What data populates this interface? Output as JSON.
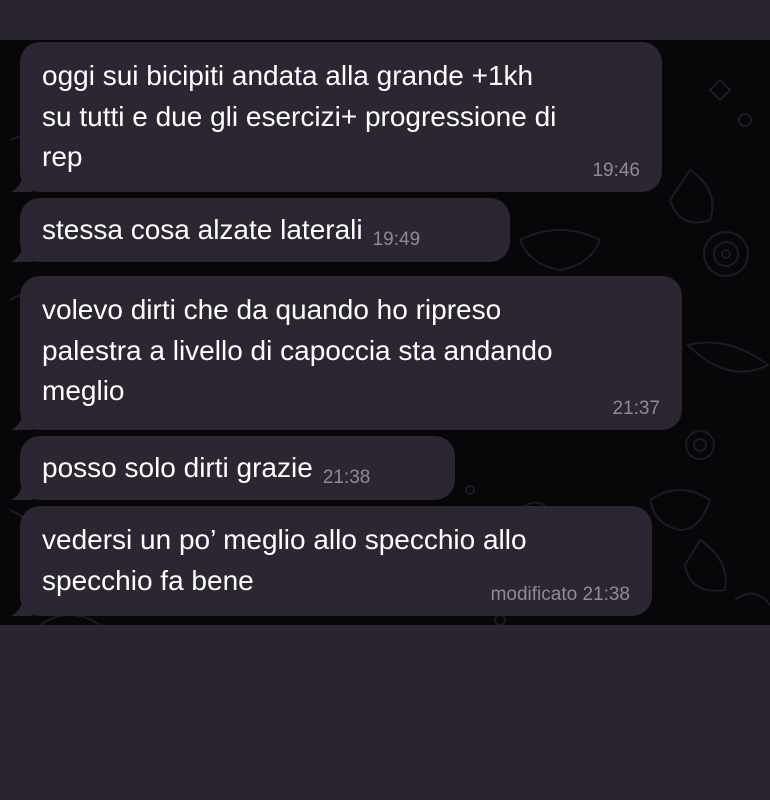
{
  "messages": [
    {
      "lines": [
        "oggi sui bicipiti andata alla grande +1kh",
        "su tutti e due gli esercizi+ progressione di",
        "rep"
      ],
      "time": "19:46"
    },
    {
      "lines": [
        "stessa cosa alzate laterali"
      ],
      "time": "19:49"
    },
    {
      "lines": [
        "volevo dirti che da quando ho ripreso",
        "palestra a livello di capoccia sta andando",
        "meglio"
      ],
      "time": "21:37"
    },
    {
      "lines": [
        "posso solo dirti grazie"
      ],
      "time": "21:38"
    },
    {
      "lines": [
        "vedersi un po’ meglio allo specchio allo",
        "specchio fa bene"
      ],
      "time": "modificato 21:38"
    }
  ],
  "colors": {
    "background": "#2a2430",
    "chat_background": "#07070a",
    "bubble": "#2b2631",
    "text": "#ffffff",
    "timestamp": "#8e8a97"
  }
}
